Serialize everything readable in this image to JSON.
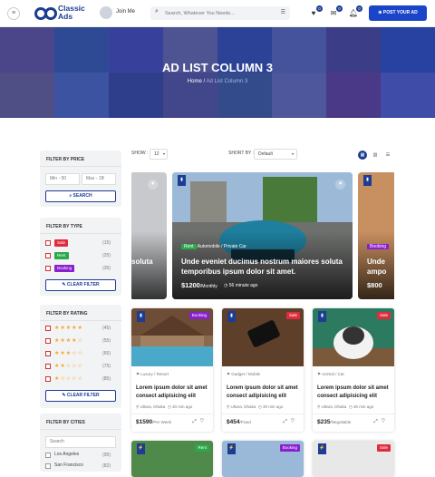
{
  "header": {
    "logo_text": "Classic\nAds",
    "logo_line1": "Classic",
    "logo_line2": "Ads",
    "join_label": "Join Me",
    "search_placeholder": "Search, Whatever You Needs...",
    "compare_badge": "0",
    "messages_badge": "0",
    "notifications_badge": "0",
    "post_button": "POST YOUR AD"
  },
  "hero": {
    "title": "AD LIST COLUMN 3",
    "breadcrumb_home": "Home",
    "breadcrumb_sep": " / ",
    "breadcrumb_current": "Ad List Column 3"
  },
  "filter_price": {
    "title": "FILTER BY PRICE",
    "min_placeholder": "Min - 00",
    "max_placeholder": "Max - 1B",
    "search_button": "SEARCH"
  },
  "filter_type": {
    "title": "FILTER BY TYPE",
    "items": [
      {
        "label": "Sale",
        "count": "(15)",
        "color": "#e02b3c"
      },
      {
        "label": "Rent",
        "count": "(25)",
        "color": "#2aa84a"
      },
      {
        "label": "Booking",
        "count": "(35)",
        "color": "#8a1fd0"
      }
    ],
    "clear_button": "CLEAR FILTER"
  },
  "filter_rating": {
    "title": "FILTER BY RATING",
    "items": [
      {
        "stars": "★★★★★",
        "count": "(45)",
        "value": 5
      },
      {
        "stars": "★★★★☆",
        "count": "(55)",
        "value": 4
      },
      {
        "stars": "★★★☆☆",
        "count": "(65)",
        "value": 3
      },
      {
        "stars": "★★☆☆☆",
        "count": "(75)",
        "value": 2
      },
      {
        "stars": "★☆☆☆☆",
        "count": "(85)",
        "value": 1
      }
    ],
    "clear_button": "CLEAR FILTER"
  },
  "filter_cities": {
    "title": "FILTER BY CITIES",
    "search_placeholder": "Search",
    "items": [
      {
        "label": "Los Angeles",
        "count": "(95)"
      },
      {
        "label": "San Francisco",
        "count": "(82)"
      }
    ]
  },
  "controls": {
    "show_label": "SHOW :",
    "show_value": "12",
    "sort_label": "SHORT BY :",
    "sort_value": "Default"
  },
  "slider": {
    "left_partial_title": "soluta",
    "right_partial_title": "Unde",
    "right_partial_title2": "ampo",
    "right_partial_price": "$800",
    "right_partial_tag": "Booking",
    "featured": {
      "tag": "Rent",
      "category": "Automobile",
      "subcategory": "Private Car",
      "title": "Unde eveniet ducimus nostrum maiores soluta temporibus ipsum dolor sit amet.",
      "price": "$1200",
      "price_unit": "/Monthly",
      "time": "56 minute ago"
    }
  },
  "cards": [
    {
      "badge": "Booking",
      "badge_color": "#8a1fd0",
      "category": "Luxury",
      "subcategory": "Resort",
      "title": "Lorem ipsum dolor sit amet consect adipisicing elit",
      "location": "Uttara, Dhaka",
      "time": "30 min ago",
      "price": "$1590",
      "price_unit": "/Per Week"
    },
    {
      "badge": "Sale",
      "badge_color": "#e02b3c",
      "category": "Gadget",
      "subcategory": "Mobile",
      "title": "Lorem ipsum dolor sit amet consect adipisicing elit",
      "location": "Uttara, Dhaka",
      "time": "30 min ago",
      "price": "$454",
      "price_unit": "/Fixed"
    },
    {
      "badge": "Sale",
      "badge_color": "#e02b3c",
      "category": "Animal",
      "subcategory": "Cat",
      "title": "Lorem ipsum dolor sit amet consect adipisicing elit",
      "location": "Uttara, Dhaka",
      "time": "30 min ago",
      "price": "$235",
      "price_unit": "/Negotiable"
    }
  ],
  "cards_row2": [
    {
      "badge": "Rent",
      "badge_color": "#2aa84a"
    },
    {
      "badge": "Booking",
      "badge_color": "#8a1fd0"
    },
    {
      "badge": "Sale",
      "badge_color": "#e02b3c"
    }
  ],
  "colors": {
    "primary": "#1c3d93",
    "accent": "#1b45c8",
    "star": "#f5a623"
  }
}
